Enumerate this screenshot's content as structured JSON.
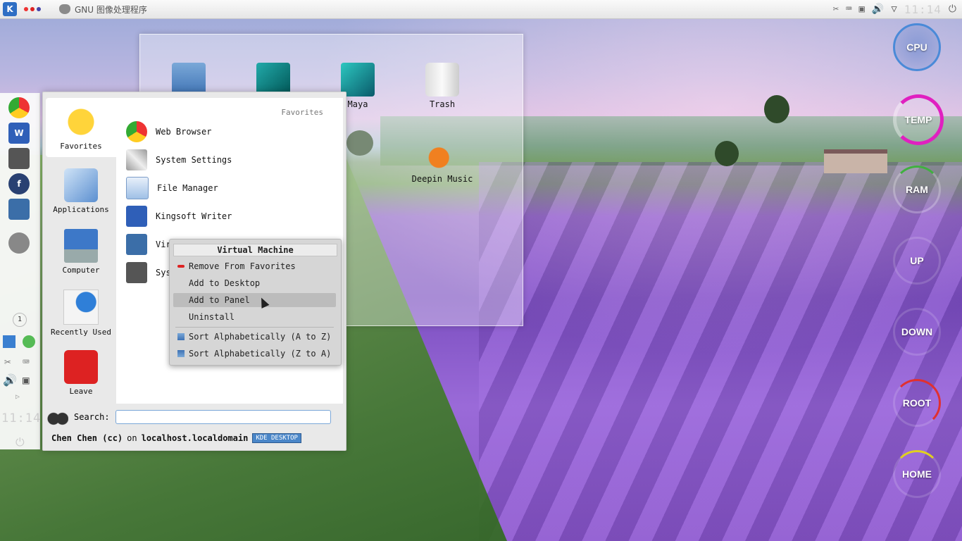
{
  "top_panel": {
    "task_title": "GNU 图像处理程序",
    "clock": "11:14"
  },
  "colors": {
    "accent": "#2f6fc4",
    "gauge_cpu": "#4a8ad8",
    "gauge_temp": "#e020c0",
    "gauge_ram": "#40b040",
    "gauge_root": "#e03030",
    "gauge_home": "#e0d020"
  },
  "desktop": {
    "icons": [
      {
        "label": ""
      },
      {
        "label": ""
      },
      {
        "label": "Maya"
      },
      {
        "label": "Trash"
      },
      {
        "label": "Deepin Music"
      }
    ]
  },
  "launcher": {
    "tabs": [
      {
        "label": "Favorites"
      },
      {
        "label": "Applications"
      },
      {
        "label": "Computer"
      },
      {
        "label": "Recently Used"
      },
      {
        "label": "Leave"
      }
    ],
    "favorites_header": "Favorites",
    "favorites": [
      {
        "label": "Web Browser"
      },
      {
        "label": "System Settings"
      },
      {
        "label": "File Manager"
      },
      {
        "label": "Kingsoft Writer"
      },
      {
        "label": "Virtual Machine"
      },
      {
        "label": "Sys"
      }
    ],
    "search_label": "Search:",
    "user_name": "Chen Chen (cc)",
    "user_on": "on",
    "hostname": "localhost.localdomain",
    "badge": "KDE DESKTOP"
  },
  "context_menu": {
    "title": "Virtual Machine",
    "items": [
      {
        "label": "Remove From Favorites"
      },
      {
        "label": "Add to Desktop"
      },
      {
        "label": "Add to Panel"
      },
      {
        "label": "Uninstall"
      },
      {
        "label": "Sort Alphabetically (A to Z)"
      },
      {
        "label": "Sort Alphabetically (Z to A)"
      }
    ]
  },
  "gauges": [
    {
      "label": "CPU"
    },
    {
      "label": "TEMP"
    },
    {
      "label": "RAM"
    },
    {
      "label": "UP"
    },
    {
      "label": "DOWN"
    },
    {
      "label": "ROOT"
    },
    {
      "label": "HOME"
    }
  ],
  "left_dock": {
    "clock": "11:14",
    "counter": "1"
  }
}
